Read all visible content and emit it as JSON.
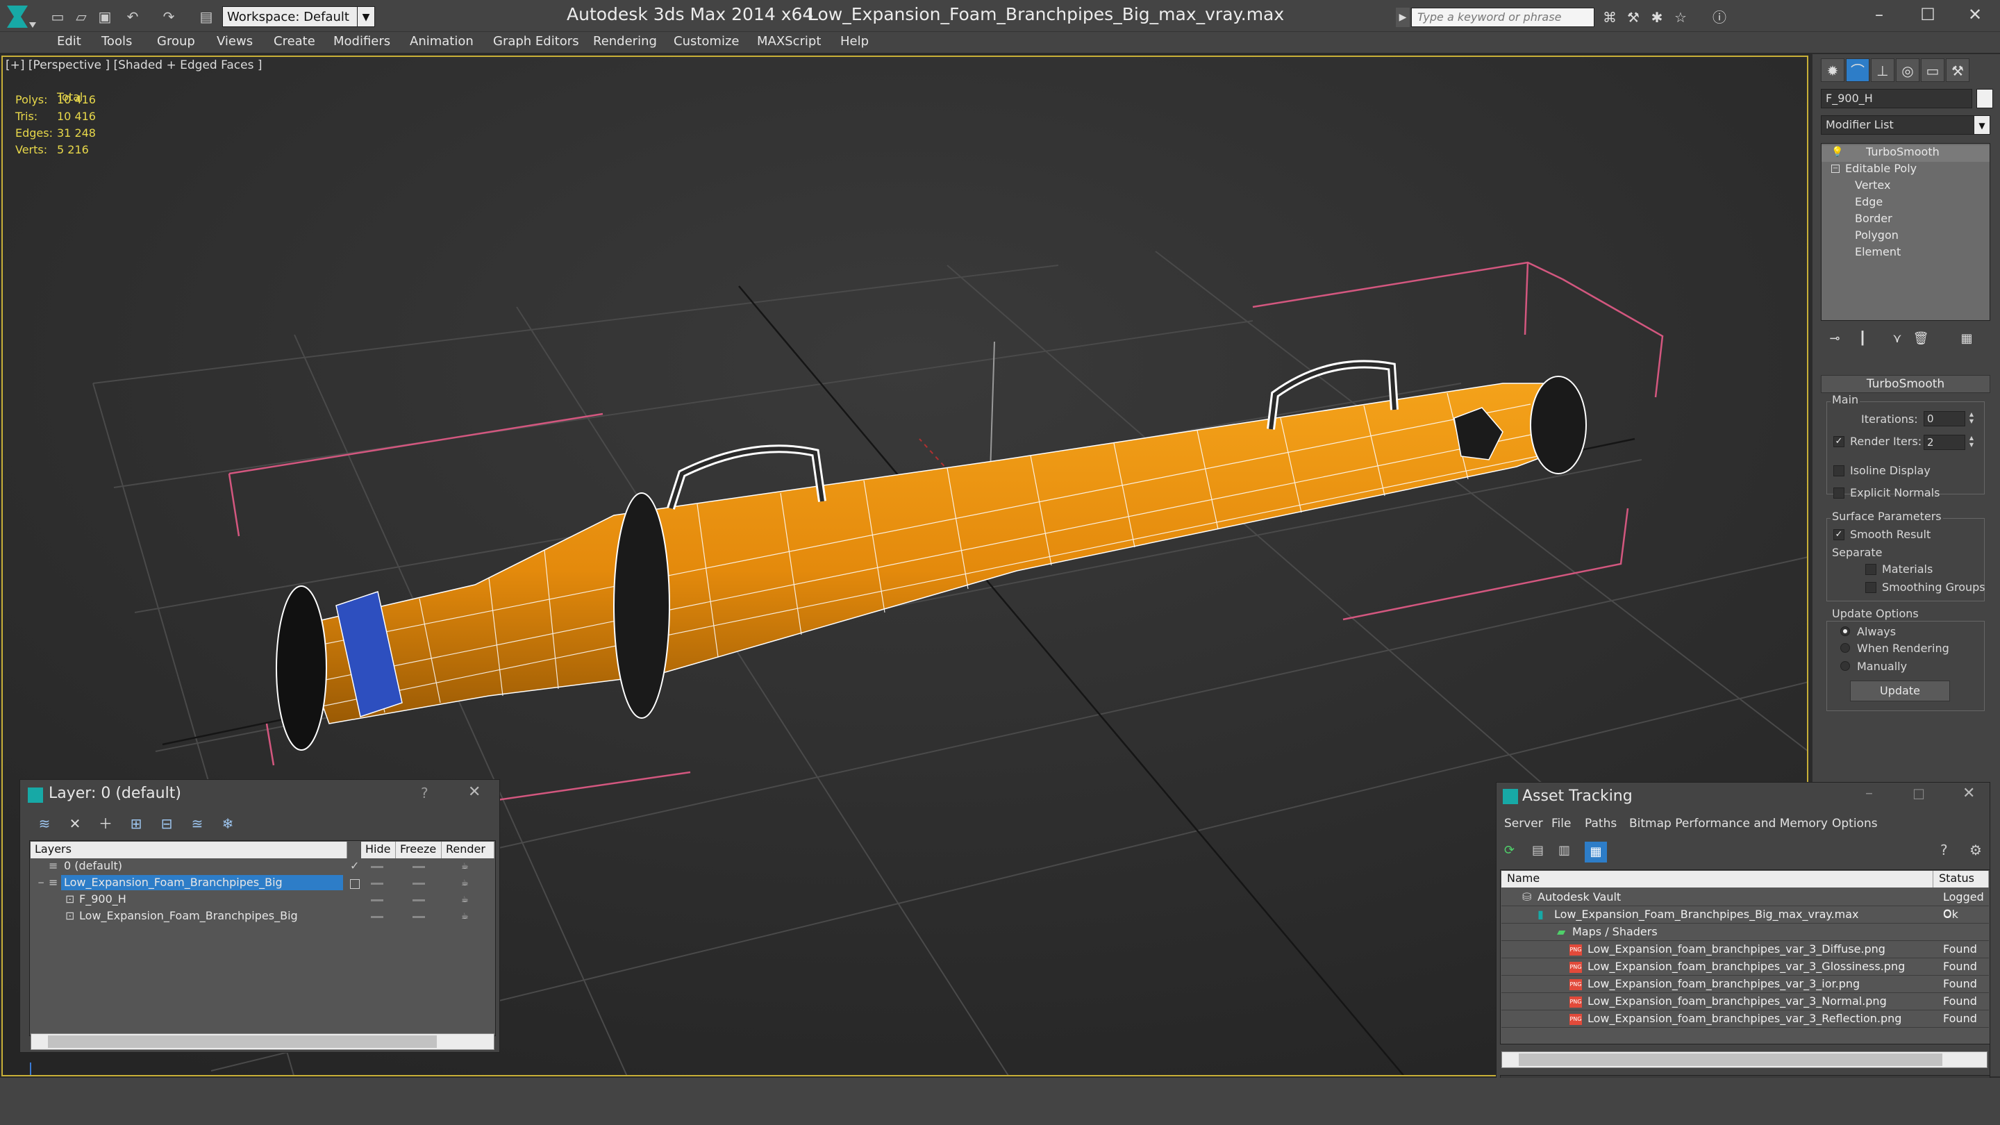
{
  "titlebar": {
    "workspace": "Workspace: Default",
    "app_title": "Autodesk 3ds Max  2014 x64",
    "file_title": "Low_Expansion_Foam_Branchpipes_Big_max_vray.max",
    "search_placeholder": "Type a keyword or phrase"
  },
  "menu": [
    "Edit",
    "Tools",
    "Group",
    "Views",
    "Create",
    "Modifiers",
    "Animation",
    "Graph Editors",
    "Rendering",
    "Customize",
    "MAXScript",
    "Help"
  ],
  "viewport": {
    "label": "[+] [Perspective ] [Shaded + Edged Faces ]",
    "stats_header": "Total",
    "stats": [
      {
        "label": "Polys:",
        "value": "10 416"
      },
      {
        "label": "Tris:",
        "value": "10 416"
      },
      {
        "label": "Edges:",
        "value": "31 248"
      },
      {
        "label": "Verts:",
        "value": "5 216"
      }
    ]
  },
  "command_panel": {
    "object_name": "F_900_H",
    "modifier_list": "Modifier List",
    "stack": [
      "TurboSmooth",
      "Editable Poly",
      "Vertex",
      "Edge",
      "Border",
      "Polygon",
      "Element"
    ],
    "rollout_title": "TurboSmooth",
    "main_group": "Main",
    "iterations_label": "Iterations:",
    "iterations_value": "0",
    "render_iters_label": "Render Iters:",
    "render_iters_value": "2",
    "isoline_display": "Isoline Display",
    "explicit_normals": "Explicit Normals",
    "surface_params": "Surface Parameters",
    "smooth_result": "Smooth Result",
    "separate": "Separate",
    "materials": "Materials",
    "smoothing_groups": "Smoothing Groups",
    "update_options": "Update Options",
    "always": "Always",
    "when_rendering": "When Rendering",
    "manually": "Manually",
    "update_button": "Update"
  },
  "layer_dialog": {
    "title": "Layer: 0 (default)",
    "help": "?",
    "columns": [
      "Layers",
      "Hide",
      "Freeze",
      "Render"
    ],
    "rows": [
      {
        "name": "0 (default)"
      },
      {
        "name": "Low_Expansion_Foam_Branchpipes_Big"
      },
      {
        "name": "F_900_H"
      },
      {
        "name": "Low_Expansion_Foam_Branchpipes_Big"
      }
    ]
  },
  "asset_tracking": {
    "title": "Asset Tracking",
    "menu": [
      "Server",
      "File",
      "Paths",
      "Bitmap Performance and Memory",
      "Options"
    ],
    "columns": [
      "Name",
      "Status"
    ],
    "rows": [
      {
        "name": "Autodesk Vault",
        "status": "Logged O"
      },
      {
        "name": "Low_Expansion_Foam_Branchpipes_Big_max_vray.max",
        "status": "Ok"
      },
      {
        "name": "Maps / Shaders",
        "status": ""
      },
      {
        "name": "Low_Expansion_foam_branchpipes_var_3_Diffuse.png",
        "status": "Found"
      },
      {
        "name": "Low_Expansion_foam_branchpipes_var_3_Glossiness.png",
        "status": "Found"
      },
      {
        "name": "Low_Expansion_foam_branchpipes_var_3_ior.png",
        "status": "Found"
      },
      {
        "name": "Low_Expansion_foam_branchpipes_var_3_Normal.png",
        "status": "Found"
      },
      {
        "name": "Low_Expansion_foam_branchpipes_var_3_Reflection.png",
        "status": "Found"
      }
    ]
  },
  "colors": {
    "viewport_border": "#c9b038",
    "stats_text": "#e8d84a",
    "model_orange": "#e48a0c",
    "selection_blue": "#2d7dc8"
  }
}
